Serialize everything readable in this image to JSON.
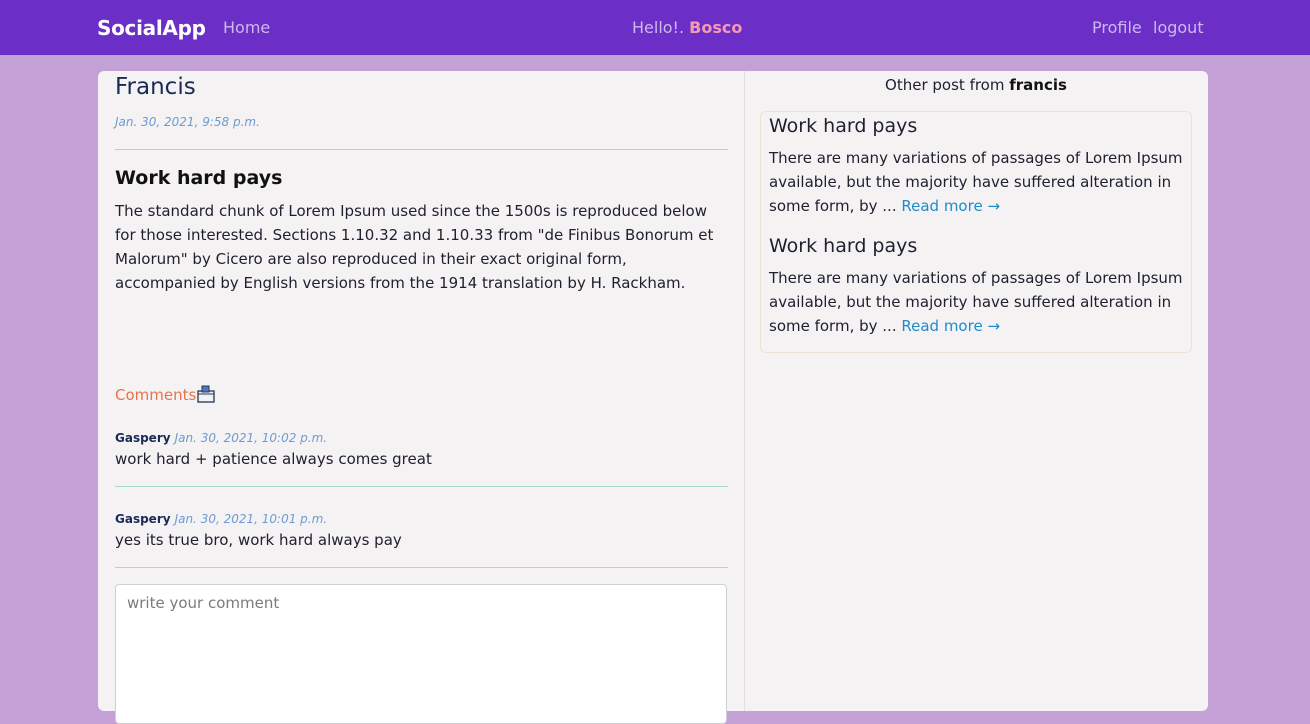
{
  "nav": {
    "brand": "SocialApp",
    "home": "Home",
    "greeting_prefix": "Hello!. ",
    "greeting_user": "Bosco",
    "profile": "Profile",
    "logout": "logout"
  },
  "post": {
    "author": "Francis",
    "date": "Jan. 30, 2021, 9:58 p.m.",
    "title": "Work hard pays",
    "body": "The standard chunk of Lorem Ipsum used since the 1500s is reproduced below for those interested. Sections 1.10.32 and 1.10.33 from \"de Finibus Bonorum et Malorum\" by Cicero are also reproduced in their exact original form, accompanied by English versions from the 1914 translation by H. Rackham."
  },
  "comments": {
    "label": "Comments",
    "icon": "mailbox-icon",
    "items": [
      {
        "author": "Gaspery",
        "date": "Jan. 30, 2021, 10:02 p.m.",
        "text": "work hard + patience always comes great"
      },
      {
        "author": "Gaspery",
        "date": "Jan. 30, 2021, 10:01 p.m.",
        "text": "yes its true bro, work hard always pay"
      }
    ],
    "input_placeholder": "write your comment"
  },
  "other_posts": {
    "heading_prefix": "Other post from ",
    "heading_user": "francis",
    "items": [
      {
        "title": "Work hard pays",
        "excerpt": "There are many variations of passages of Lorem Ipsum available, but the majority have suffered alteration in some form, by ... ",
        "read_more": "Read more →"
      },
      {
        "title": "Work hard pays",
        "excerpt": "There are many variations of passages of Lorem Ipsum available, but the majority have suffered alteration in some form, by ... ",
        "read_more": "Read more →"
      }
    ]
  },
  "colors": {
    "navbar": "#6b2fc7",
    "page_background": "#c3a0d6",
    "card": "#f5f2f4",
    "greeting_user": "#f59ab0",
    "comments_label": "#e8734a",
    "link": "#1f8cc9"
  }
}
